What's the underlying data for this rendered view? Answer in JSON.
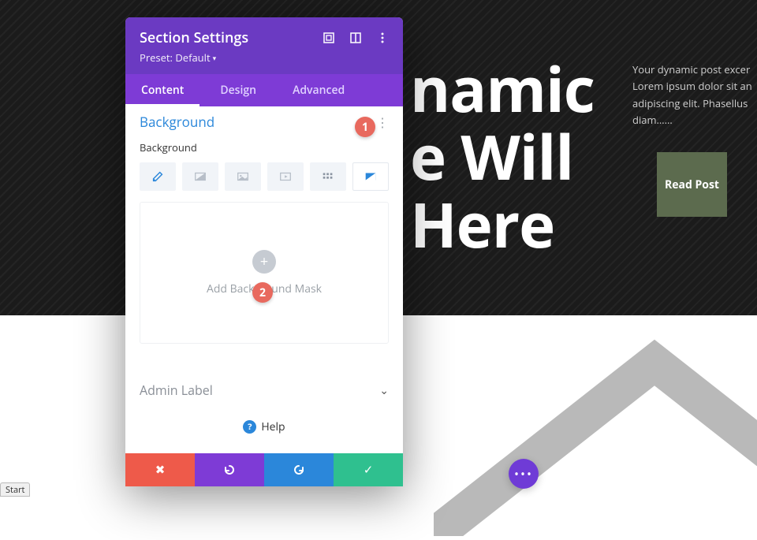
{
  "hero": {
    "line1": "namic",
    "line2": "e Will",
    "line3": "Here"
  },
  "excerpt": "Your dynamic post excer Lorem ipsum dolor sit an adipiscing elit. Phasellus diam……",
  "read_post": "Read Post",
  "fab_label": "•••",
  "start_label": "Start",
  "modal": {
    "title": "Section Settings",
    "preset": "Preset: Default",
    "tabs": {
      "content": "Content",
      "design": "Design",
      "advanced": "Advanced"
    },
    "section_title": "Background",
    "sub_label": "Background",
    "mask_label": "Add Background Mask",
    "admin_label": "Admin Label",
    "help": "Help"
  },
  "badges": {
    "b1": "1",
    "b2": "2"
  }
}
